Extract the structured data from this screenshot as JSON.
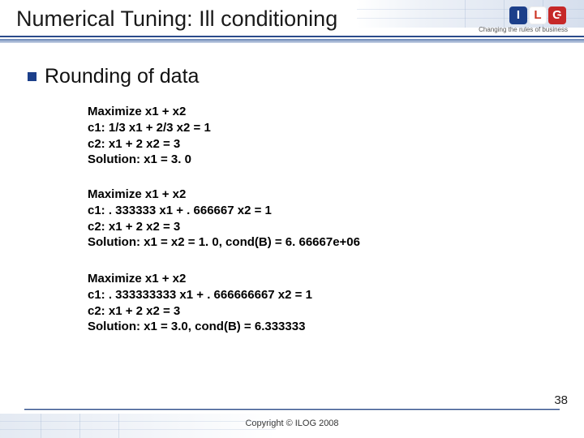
{
  "title": "Numerical Tuning: Ill conditioning",
  "logo": {
    "letters": [
      "I",
      "L",
      "G"
    ],
    "tagline": "Changing the rules of business"
  },
  "bullet": "Rounding of data",
  "blocks": {
    "b1": {
      "l1": "Maximize  x1 + x2",
      "l2": "c1: 1/3 x1 + 2/3 x2 = 1",
      "l3": "c2: x1 + 2 x2 = 3",
      "l4": "Solution: x1 = 3. 0"
    },
    "b2": {
      "l1": "Maximize  x1 + x2",
      "l2": "c1: . 333333 x1 + . 666667 x2 = 1",
      "l3": "c2: x1 + 2 x2 = 3",
      "l4": "Solution: x1 = x2 = 1. 0, cond(B) = 6. 66667e+06"
    },
    "b3": {
      "l1": "Maximize x1 + x2",
      "l2": "c1: . 333333333 x1 + . 666666667 x2 = 1",
      "l3": "c2: x1 + 2 x2 = 3",
      "l4": "Solution: x1 = 3.0, cond(B) = 6.333333"
    }
  },
  "pagenum": "38",
  "copyright": "Copyright © ILOG 2008"
}
